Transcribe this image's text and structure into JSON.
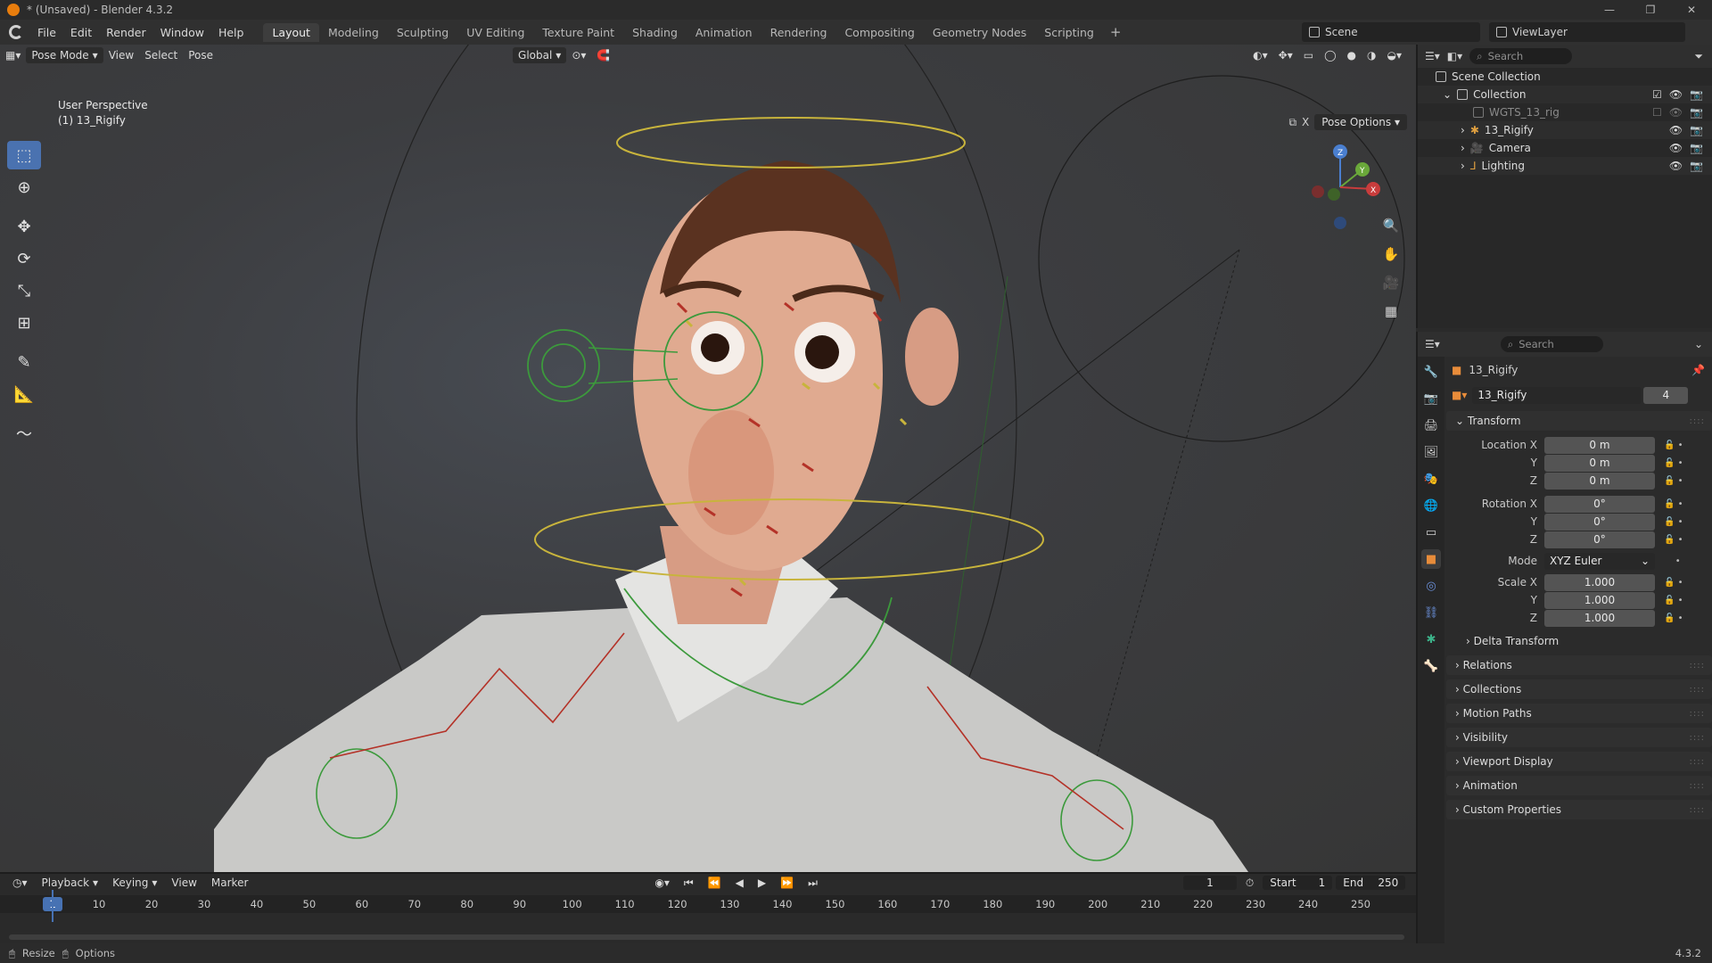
{
  "window": {
    "title": "* (Unsaved) - Blender 4.3.2",
    "min": "—",
    "max": "❐",
    "close": "✕"
  },
  "menu": {
    "items": [
      "File",
      "Edit",
      "Render",
      "Window",
      "Help"
    ]
  },
  "workspaces": [
    "Layout",
    "Modeling",
    "Sculpting",
    "UV Editing",
    "Texture Paint",
    "Shading",
    "Animation",
    "Rendering",
    "Compositing",
    "Geometry Nodes",
    "Scripting"
  ],
  "scene": {
    "name": "Scene",
    "view_layer": "ViewLayer"
  },
  "viewport": {
    "mode": "Pose Mode",
    "menus": [
      "View",
      "Select",
      "Pose"
    ],
    "orientation": "Global",
    "perspective": "User Perspective",
    "active_object": "(1) 13_Rigify",
    "pose_options": "Pose Options",
    "gizmo": {
      "x": "X",
      "y": "Y",
      "z": "Z"
    }
  },
  "outliner": {
    "search_placeholder": "Search",
    "root": "Scene Collection",
    "collection": "Collection",
    "items": [
      {
        "name": "WGTS_13_rig"
      },
      {
        "name": "13_Rigify"
      },
      {
        "name": "Camera"
      },
      {
        "name": "Lighting"
      }
    ]
  },
  "properties": {
    "search_placeholder": "Search",
    "object_name": "13_Rigify",
    "data_name": "13_Rigify",
    "users": "4",
    "transform_label": "Transform",
    "location": {
      "x_label": "Location X",
      "y_label": "Y",
      "z_label": "Z",
      "x": "0 m",
      "y": "0 m",
      "z": "0 m"
    },
    "rotation": {
      "x_label": "Rotation X",
      "y_label": "Y",
      "z_label": "Z",
      "x": "0°",
      "y": "0°",
      "z": "0°"
    },
    "mode_label": "Mode",
    "mode_value": "XYZ Euler",
    "scale": {
      "x_label": "Scale X",
      "y_label": "Y",
      "z_label": "Z",
      "x": "1.000",
      "y": "1.000",
      "z": "1.000"
    },
    "panels": [
      "Delta Transform",
      "Relations",
      "Collections",
      "Motion Paths",
      "Visibility",
      "Viewport Display",
      "Animation",
      "Custom Properties"
    ]
  },
  "timeline": {
    "menus": [
      "Playback",
      "Keying",
      "View",
      "Marker"
    ],
    "current_frame": "1",
    "start_label": "Start",
    "start": "1",
    "end_label": "End",
    "end": "250",
    "ticks": [
      "1",
      "10",
      "20",
      "30",
      "40",
      "50",
      "60",
      "70",
      "80",
      "90",
      "100",
      "110",
      "120",
      "130",
      "140",
      "150",
      "160",
      "170",
      "180",
      "190",
      "200",
      "210",
      "220",
      "230",
      "240",
      "250"
    ]
  },
  "status": {
    "resize": "Resize",
    "options": "Options",
    "version": "4.3.2"
  },
  "colors": {
    "accent": "#4772b3",
    "rig_yellow": "#c8b43c",
    "rig_green": "#3c9a3c",
    "rig_red": "#b43228"
  }
}
